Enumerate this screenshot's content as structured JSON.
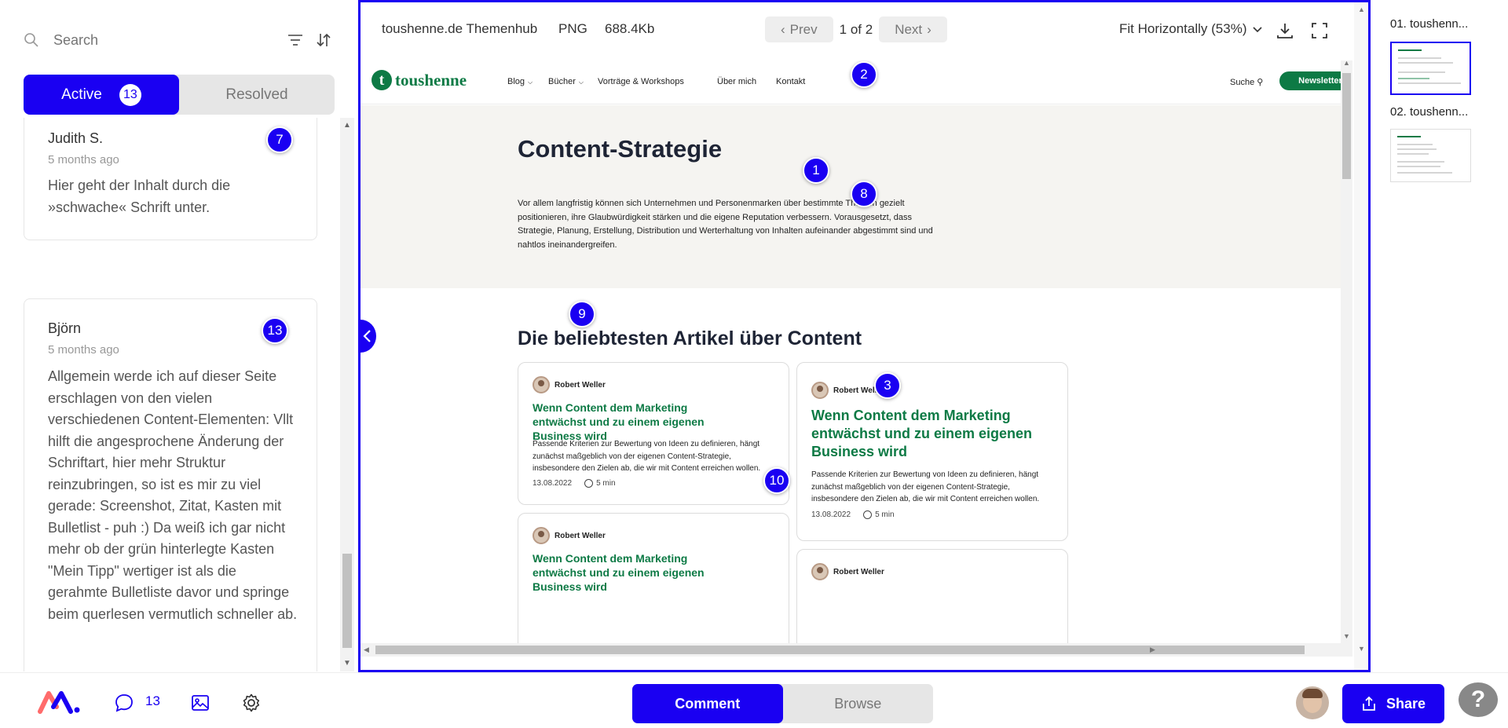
{
  "sidebar": {
    "search_placeholder": "Search",
    "tabs": {
      "active_label": "Active",
      "active_count": "13",
      "resolved_label": "Resolved"
    },
    "comments": [
      {
        "author": "Judith S.",
        "time": "5 months ago",
        "pin": "7",
        "text": "Hier geht der Inhalt durch die »schwache« Schrift unter."
      },
      {
        "author": "Björn",
        "time": "5 months ago",
        "pin": "13",
        "text": "Allgemein werde ich auf dieser Seite erschlagen von den vielen verschiedenen Content-Elementen: Vllt hilft die angesprochene Änderung der Schriftart, hier mehr Struktur reinzubringen, so ist es mir zu viel gerade: Screenshot, Zitat, Kasten mit Bulletlist - puh :) Da weiß ich gar nicht mehr ob der grün hinterlegte Kasten \"Mein Tipp\" wertiger ist als die gerahmte Bulletliste davor und springe beim querlesen vermutlich schneller ab."
      }
    ]
  },
  "viewer": {
    "file_name": "toushenne.de Themenhub",
    "file_type": "PNG",
    "file_size": "688.4Kb",
    "prev_label": "Prev",
    "page_info": "1 of 2",
    "next_label": "Next",
    "zoom_label": "Fit Horizontally (53%)"
  },
  "site": {
    "logo_mark": "t",
    "logo_text": "toushenne",
    "nav": [
      "Blog",
      "Bücher",
      "Vorträge & Workshops",
      "Über mich",
      "Kontakt"
    ],
    "search_label": "Suche",
    "newsletter_label": "Newsletter",
    "hero_title": "Content-Strategie",
    "hero_text": "Vor allem langfristig können sich Unternehmen und Personenmarken über bestimmte Themen gezielt positionieren, ihre Glaubwürdigkeit stärken und die eigene Reputation verbessern. Vorausgesetzt, dass Strategie, Planung, Erstellung, Distribution und Werterhaltung von Inhalten aufeinander abgestimmt sind und nahtlos ineinandergreifen.",
    "section_title": "Die beliebtesten Artikel über Content",
    "cards": [
      {
        "author": "Robert Weller",
        "title": "Wenn Content dem Marketing entwächst und zu einem eigenen Business wird",
        "excerpt": "Passende Kriterien zur Bewertung von Ideen zu definieren, hängt zunächst maßgeblich von der eigenen Content-Strategie, insbesondere den Zielen ab, die wir mit Content erreichen wollen.",
        "date": "13.08.2022",
        "read_time": "5 min"
      },
      {
        "author": "Robert Weller",
        "title": "Wenn Content dem Marketing entwächst und zu einem eigenen Business wird",
        "excerpt": "Passende Kriterien zur Bewertung von Ideen zu definieren, hängt zunächst maßgeblich von der eigenen Content-Strategie, insbesondere den Zielen ab, die wir mit Content erreichen wollen.",
        "date": "13.08.2022",
        "read_time": "5 min"
      },
      {
        "author": "Robert Weller",
        "title": "Wenn Content dem Marketing entwächst und zu einem eigenen Business wird"
      },
      {
        "author": "Robert Weller"
      }
    ]
  },
  "pins": [
    "1",
    "2",
    "3",
    "8",
    "9",
    "10"
  ],
  "thumbnails": [
    {
      "label": "01. toushenn..."
    },
    {
      "label": "02. toushenn..."
    }
  ],
  "bottom": {
    "comment_count": "13",
    "comment_mode_label": "Comment",
    "browse_mode_label": "Browse",
    "share_label": "Share",
    "help_label": "?"
  },
  "colors": {
    "accent": "#1a00f2",
    "brand_green": "#0d7a45",
    "hero_bg": "#f5f4f1"
  }
}
